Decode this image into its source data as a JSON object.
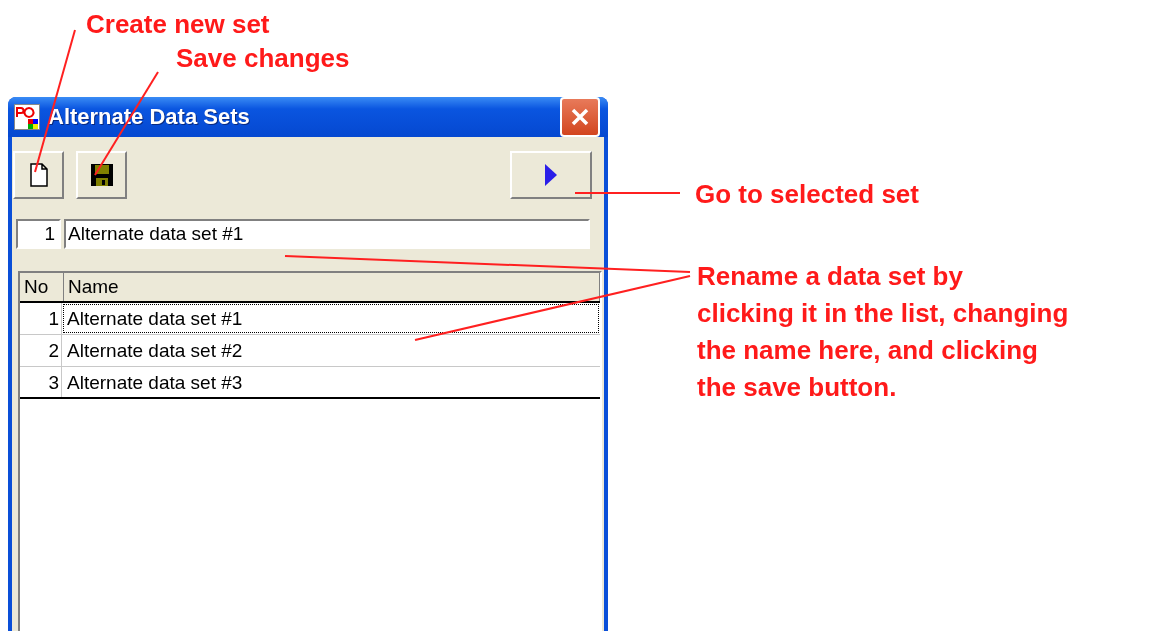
{
  "window": {
    "title": "Alternate Data Sets"
  },
  "toolbar": [
    {
      "kind": "new"
    },
    {
      "kind": "save"
    },
    {
      "kind": "go"
    }
  ],
  "current": {
    "number": "1",
    "value": "Alternate data set #1"
  },
  "table": {
    "columns": [
      "No",
      "Name"
    ],
    "rows": [
      {
        "no": "1",
        "name": "Alternate data set #1",
        "selected": true
      },
      {
        "no": "2",
        "name": "Alternate data set #2",
        "selected": false
      },
      {
        "no": "3",
        "name": "Alternate data set #3",
        "selected": false
      }
    ]
  },
  "annotations": [
    {
      "text": "Create new set"
    },
    {
      "text": "Save changes"
    },
    {
      "text": "Go to selected set"
    },
    {
      "text": "Rename a data set by\nclicking it in the list, changing\nthe name here, and clicking\nthe save button."
    }
  ]
}
